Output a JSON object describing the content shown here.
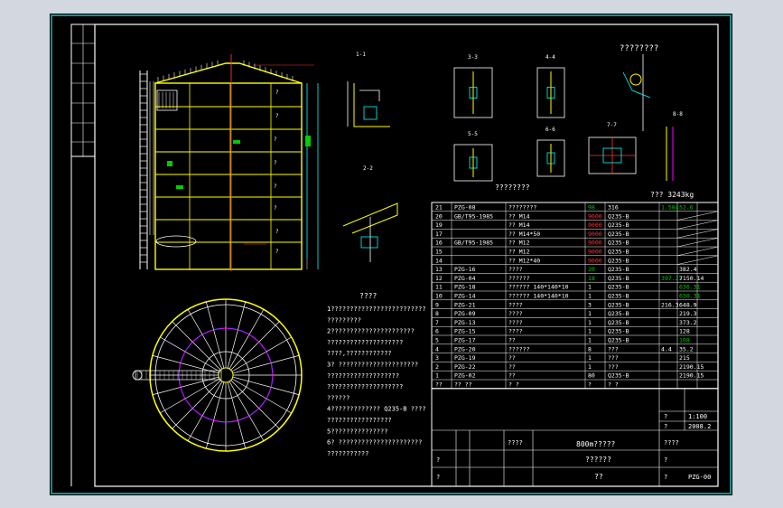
{
  "colors": {
    "outer": "#d3d7e0",
    "sheet": "#000000",
    "border": "#1a8a8a",
    "line": "#ffffff",
    "yellow": "#ffff00",
    "red": "#ff3333",
    "cyan": "#00ffff",
    "green": "#00cc00",
    "blue": "#3344ff",
    "magenta": "#ff00ff"
  },
  "section_labels": [
    "1-1",
    "2-2",
    "3-3",
    "4-4",
    "5-5",
    "6-6",
    "7-7",
    "8-8"
  ],
  "detail_title": "????????",
  "bolt_label": "????????",
  "weight_label": "??? 3243kg",
  "notes": {
    "title": "????",
    "lines": [
      "1?????????????????????????",
      "  ?????????",
      "2??????????????????????",
      "  ????????????????????",
      "  ????,????????????",
      "3? ?????????????????????",
      "  ???????????????????",
      "  ????????????????????",
      "  ??????",
      "4?????????????   Q235-B     ????",
      "  ?????????????????",
      "5???????????????",
      "6? ??????????????????????",
      "  ???????????"
    ]
  },
  "bom": [
    [
      "21",
      "PZG-08",
      "????????",
      "98",
      "316",
      "1.584",
      "52.6"
    ],
    [
      "20",
      "GB/T95-1985",
      "?? M14",
      "9000",
      "Q235-B",
      "",
      ""
    ],
    [
      "19",
      "",
      "?? M14",
      "9000",
      "Q235-B",
      "",
      ""
    ],
    [
      "17",
      "",
      "?? M14*50",
      "9000",
      "Q235-B",
      "",
      ""
    ],
    [
      "16",
      "GB/T95-1985",
      "?? M12",
      "9000",
      "Q235-B",
      "",
      ""
    ],
    [
      "15",
      "",
      "?? M12",
      "9000",
      "Q235-B",
      "",
      ""
    ],
    [
      "14",
      "",
      "?? M12*40",
      "9000",
      "Q235-B",
      "",
      ""
    ],
    [
      "13",
      "PZG-16",
      "????",
      "20",
      "Q235-B",
      "",
      "382.4"
    ],
    [
      "12",
      "PZG-04",
      "??????",
      "18",
      "Q235-B",
      "397.23",
      "7150.14"
    ],
    [
      "11",
      "PZG-18",
      "?????? 140*140*10",
      "1",
      "Q235-B",
      "",
      "636.31"
    ],
    [
      "10",
      "PZG-14",
      "?????? 140*140*10",
      "1",
      "Q235-B",
      "",
      "630.31"
    ],
    [
      "9",
      "PZG-21",
      "????",
      "3",
      "Q235-B",
      "216.3",
      "648.9"
    ],
    [
      "8",
      "PZG-09",
      "????",
      "1",
      "Q235-B",
      "",
      "219.3"
    ],
    [
      "7",
      "PZG-13",
      "????",
      "1",
      "Q235-B",
      "",
      "373.2"
    ],
    [
      "6",
      "PZG-15",
      "????",
      "1",
      "Q235-B",
      "",
      "128"
    ],
    [
      "5",
      "PZG-17",
      "??",
      "1",
      "Q235-B",
      "",
      "108"
    ],
    [
      "4",
      "PZG-20",
      "??????",
      "8",
      "???",
      "4.4",
      "35.2"
    ],
    [
      "3",
      "PZG-19",
      "??",
      "1",
      "???",
      "",
      "215"
    ],
    [
      "2",
      "PZG-22",
      "??",
      "1",
      "???",
      "",
      "2190.15"
    ],
    [
      "1",
      "PZG-02",
      "??",
      "80",
      "Q235-B",
      "",
      "2190.15"
    ],
    [
      "??",
      "?? ??",
      "?   ?",
      "?",
      "?   ?",
      "",
      ""
    ]
  ],
  "title_block": {
    "scale": "1:100",
    "date": "2008.2",
    "drawing_name": "800m?????",
    "sub_name": "??????",
    "company": "??",
    "drawing_no": "PZG-00",
    "cells": [
      "????",
      "????",
      "?",
      "?",
      "?",
      "?",
      "?",
      "?"
    ]
  }
}
